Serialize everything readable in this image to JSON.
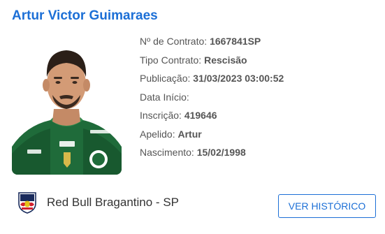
{
  "player": {
    "name": "Artur Victor Guimaraes",
    "photo_alt": "player-photo"
  },
  "details": [
    {
      "label": "Nº de Contrato:",
      "value": "1667841SP"
    },
    {
      "label": "Tipo Contrato:",
      "value": "Rescisão"
    },
    {
      "label": "Publicação:",
      "value": "31/03/2023 03:00:52"
    },
    {
      "label": "Data Início:",
      "value": ""
    },
    {
      "label": "Inscrição:",
      "value": "419646"
    },
    {
      "label": "Apelido:",
      "value": "Artur"
    },
    {
      "label": "Nascimento:",
      "value": "15/02/1998"
    }
  ],
  "club": {
    "name": "Red Bull Bragantino - SP",
    "logo_icon": "red-bull-bragantino-crest-icon"
  },
  "actions": {
    "history_label": "VER HISTÓRICO"
  },
  "colors": {
    "accent": "#1c6fd6",
    "text": "#555555",
    "jersey": "#1f6b3a"
  }
}
